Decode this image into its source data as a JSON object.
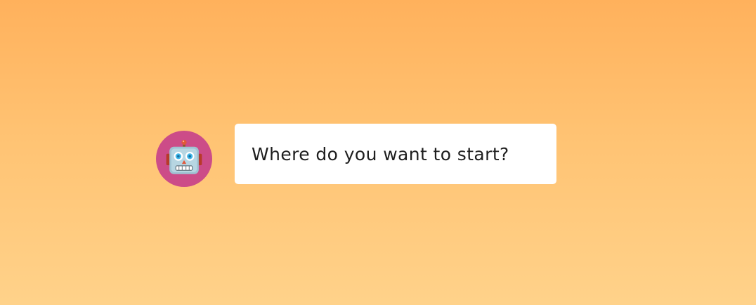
{
  "chat": {
    "avatar": {
      "icon": "robot-face-icon",
      "background_color": "#cc4c88"
    },
    "message": {
      "text": "Where do you want to start?"
    }
  },
  "colors": {
    "background_top": "#ffb15c",
    "background_bottom": "#ffd28a",
    "bubble": "#ffffff"
  }
}
